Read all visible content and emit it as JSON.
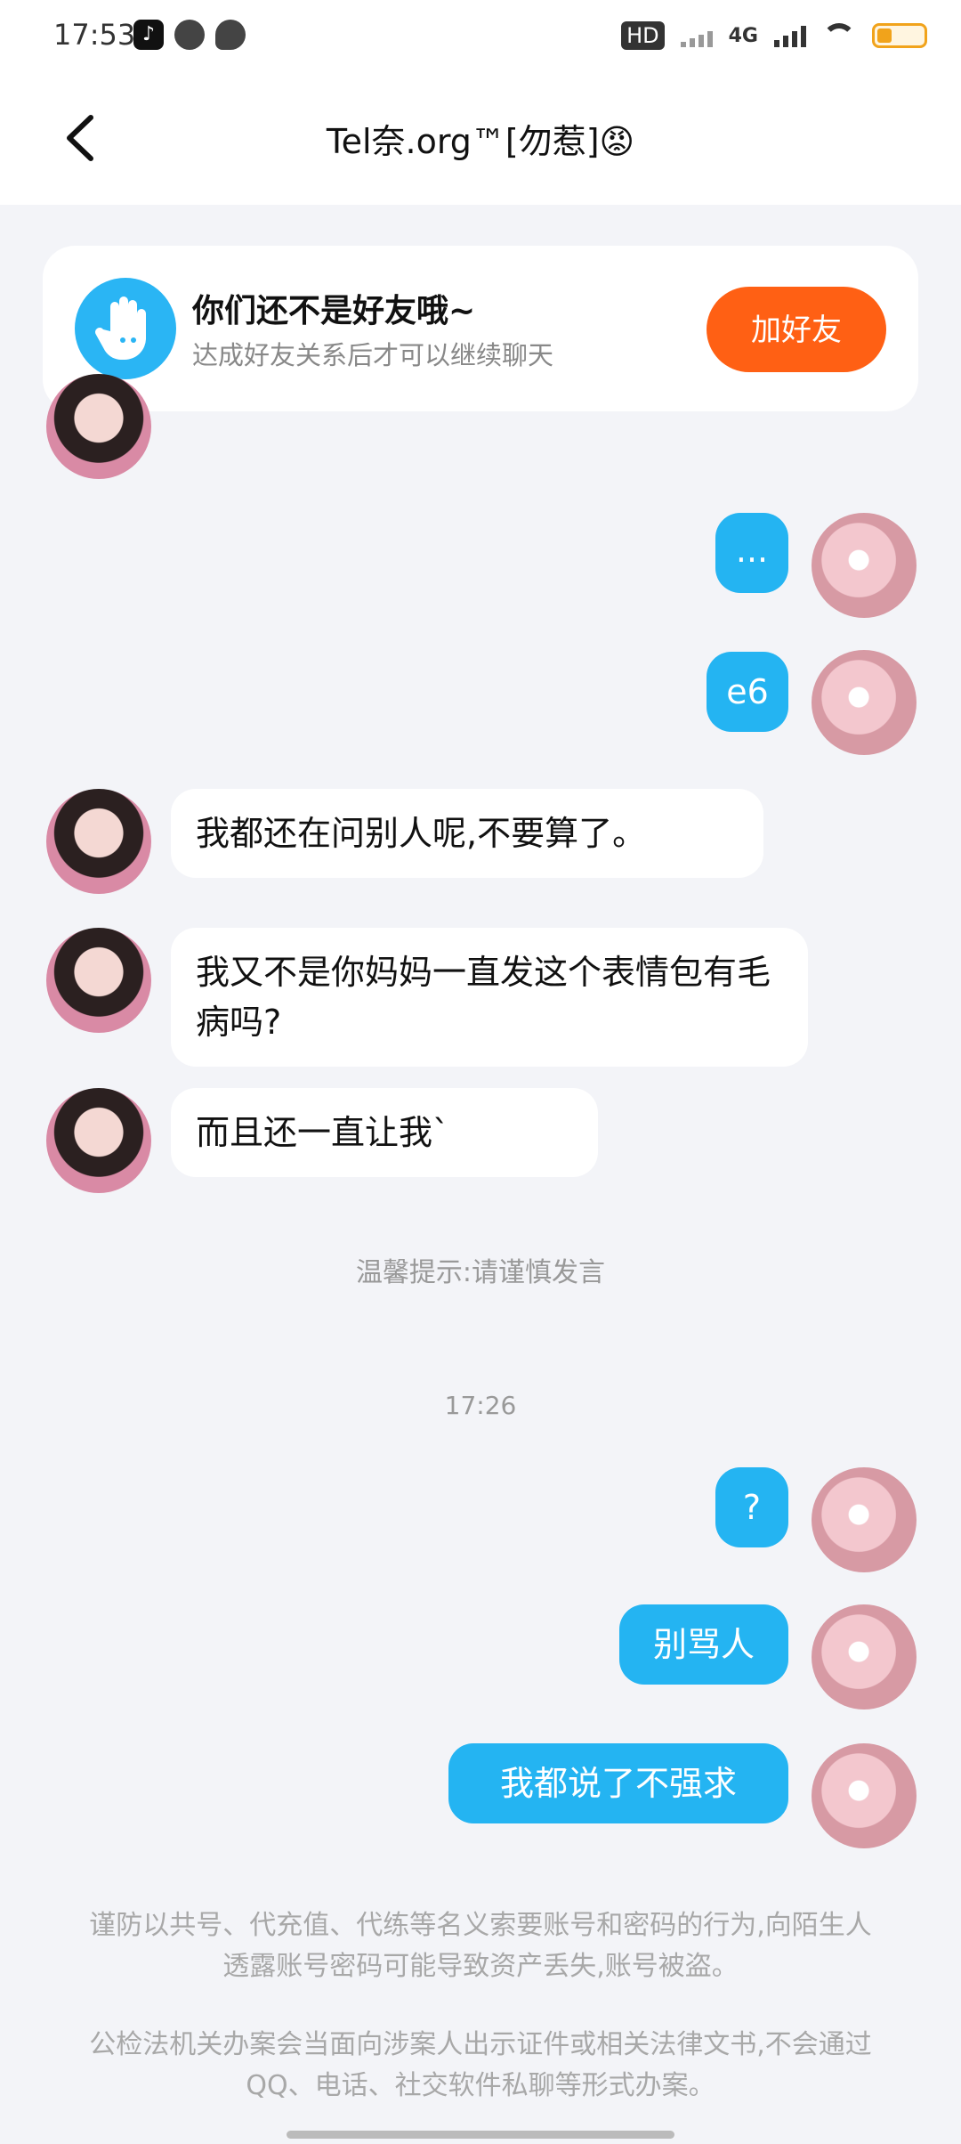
{
  "status_bar": {
    "time": "17:53",
    "app_icons": [
      "tiktok-icon",
      "app-icon",
      "chat-icon"
    ],
    "hd_label": "HD",
    "network_label": "4G"
  },
  "header": {
    "title": "Tel奈.org™[勿惹]😡"
  },
  "friend_prompt": {
    "title": "你们还不是好友哦~",
    "subtitle": "达成好友关系后才可以继续聊天",
    "button": "加好友",
    "button_color": "#ff6014"
  },
  "messages": [
    {
      "side": "out",
      "text": "..."
    },
    {
      "side": "out",
      "text": "e6"
    },
    {
      "side": "in",
      "text": "我都还在问别人呢,不要算了。"
    },
    {
      "side": "in",
      "text": "我又不是你妈妈一直发这个表情包有毛病吗?"
    },
    {
      "side": "in",
      "text": "而且还一直让我`"
    },
    {
      "side": "out",
      "text": "?"
    },
    {
      "side": "out",
      "text": "别骂人"
    },
    {
      "side": "out",
      "text": "我都说了不强求"
    }
  ],
  "system_tip": "温馨提示:请谨慎发言",
  "timestamp": "17:26",
  "notices": [
    "谨防以共号、代充值、代练等名义索要账号和密码的行为,向陌生人透露账号密码可能导致资产丢失,账号被盗。",
    "公检法机关办案会当面向涉案人出示证件或相关法律文书,不会通过QQ、电话、社交软件私聊等形式办案。"
  ],
  "colors": {
    "outgoing_bubble": "#24b4f2",
    "incoming_bubble": "#ffffff",
    "background": "#f3f4f8"
  }
}
